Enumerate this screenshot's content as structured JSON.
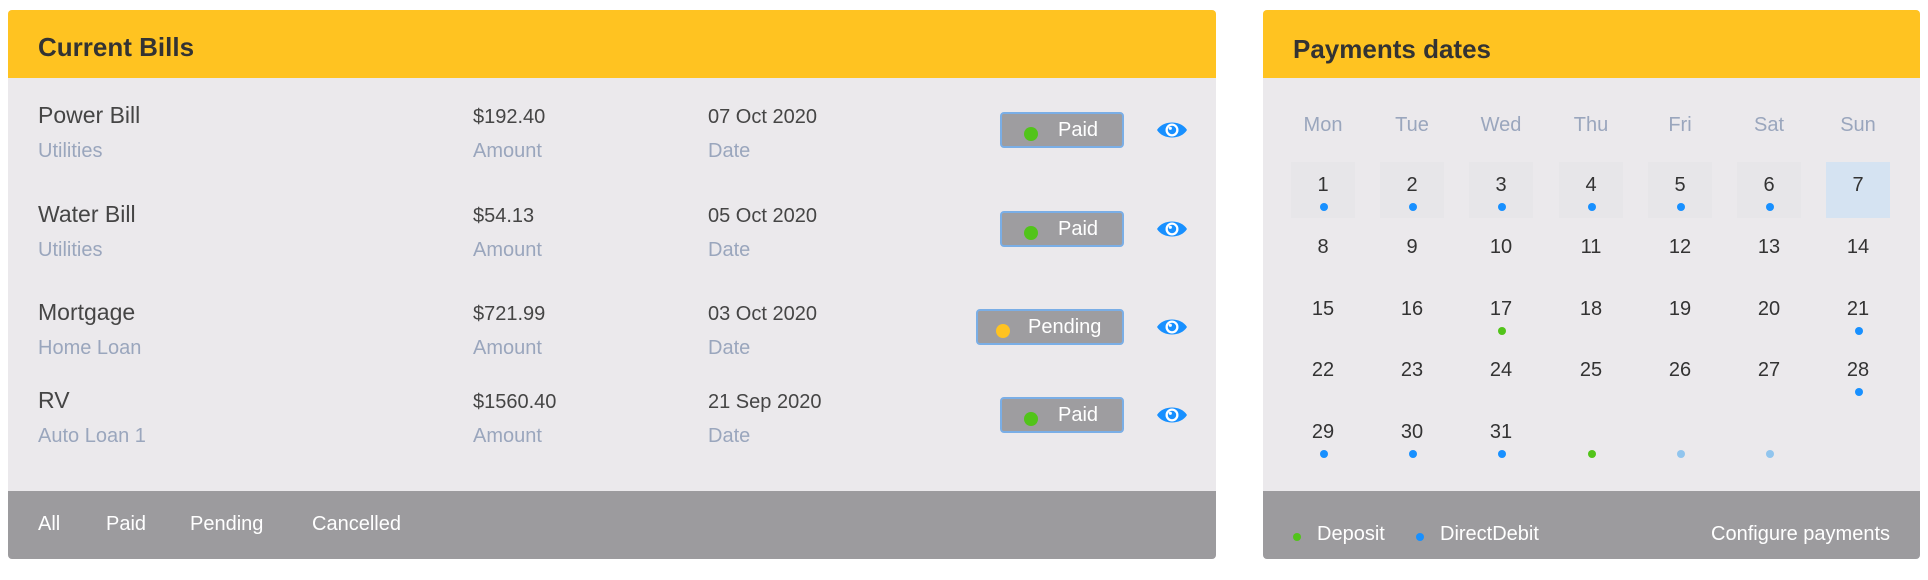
{
  "bills_card": {
    "title": "Current Bills",
    "amount_label": "Amount",
    "date_label": "Date",
    "bills": [
      {
        "name": "Power Bill",
        "category": "Utilities",
        "amount": "$192.40",
        "date": "07 Oct 2020",
        "status": "Paid",
        "status_color": "#52c41a"
      },
      {
        "name": "Water Bill",
        "category": "Utilities",
        "amount": "$54.13",
        "date": "05 Oct 2020",
        "status": "Paid",
        "status_color": "#52c41a"
      },
      {
        "name": "Mortgage",
        "category": "Home Loan",
        "amount": "$721.99",
        "date": "03 Oct 2020",
        "status": "Pending",
        "status_color": "#ffc321"
      },
      {
        "name": "RV",
        "category": "Auto Loan 1",
        "amount": "$1560.40",
        "date": "21 Sep 2020",
        "status": "Paid",
        "status_color": "#52c41a"
      }
    ],
    "filters": [
      "All",
      "Paid",
      "Pending",
      "Cancelled"
    ]
  },
  "calendar_card": {
    "title": "Payments dates",
    "weekdays": [
      "Mon",
      "Tue",
      "Wed",
      "Thu",
      "Fri",
      "Sat",
      "Sun"
    ],
    "weeks": [
      [
        {
          "n": "1",
          "dot": "debit"
        },
        {
          "n": "2",
          "dot": "debit"
        },
        {
          "n": "3",
          "dot": "debit"
        },
        {
          "n": "4",
          "dot": "debit"
        },
        {
          "n": "5",
          "dot": "debit"
        },
        {
          "n": "6",
          "dot": "debit"
        },
        {
          "n": "7",
          "dot": "",
          "selected": true
        }
      ],
      [
        {
          "n": "8",
          "dot": ""
        },
        {
          "n": "9",
          "dot": ""
        },
        {
          "n": "10",
          "dot": ""
        },
        {
          "n": "11",
          "dot": ""
        },
        {
          "n": "12",
          "dot": ""
        },
        {
          "n": "13",
          "dot": ""
        },
        {
          "n": "14",
          "dot": ""
        }
      ],
      [
        {
          "n": "15",
          "dot": ""
        },
        {
          "n": "16",
          "dot": ""
        },
        {
          "n": "17",
          "dot": "deposit"
        },
        {
          "n": "18",
          "dot": ""
        },
        {
          "n": "19",
          "dot": ""
        },
        {
          "n": "20",
          "dot": ""
        },
        {
          "n": "21",
          "dot": "debit"
        }
      ],
      [
        {
          "n": "22",
          "dot": ""
        },
        {
          "n": "23",
          "dot": ""
        },
        {
          "n": "24",
          "dot": ""
        },
        {
          "n": "25",
          "dot": ""
        },
        {
          "n": "26",
          "dot": ""
        },
        {
          "n": "27",
          "dot": ""
        },
        {
          "n": "28",
          "dot": "debit"
        }
      ],
      [
        {
          "n": "29",
          "dot": "debit"
        },
        {
          "n": "30",
          "dot": "debit"
        },
        {
          "n": "31",
          "dot": "debit"
        },
        {
          "n": "",
          "dot": "deposit"
        },
        {
          "n": "",
          "dot": "faded"
        },
        {
          "n": "",
          "dot": "faded"
        },
        {
          "n": "",
          "dot": ""
        }
      ]
    ],
    "legend": {
      "deposit": "Deposit",
      "debit": "DirectDebit"
    },
    "configure_label": "Configure payments",
    "colors": {
      "deposit": "#52c41a",
      "debit": "#1890ff",
      "faded": "#91c5ee",
      "selected_bg": "#d5e3f2"
    }
  },
  "icons": {
    "view": "eye-icon"
  },
  "colors": {
    "header": "#ffc321",
    "footer": "#9c9b9e",
    "accent": "#1890ff"
  }
}
